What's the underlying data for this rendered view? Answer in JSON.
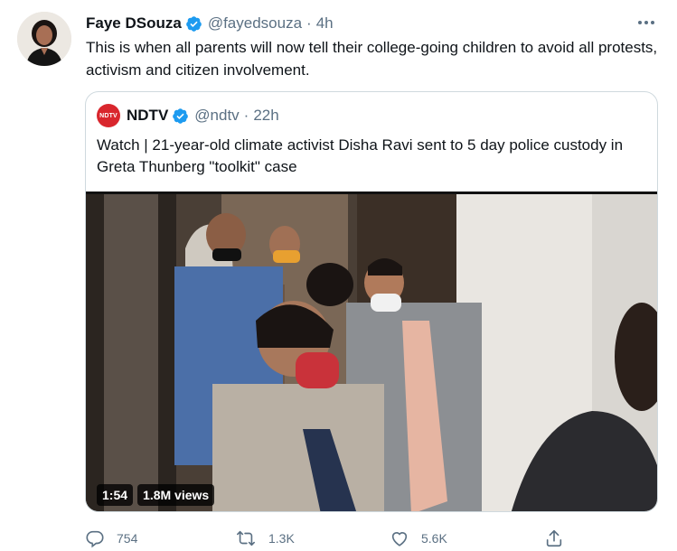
{
  "tweet": {
    "author_name": "Faye DSouza",
    "handle": "@fayedsouza",
    "separator": "·",
    "time": "4h",
    "text": "This is when all parents will now tell their college-going children to avoid all protests, activism and citizen involvement."
  },
  "quoted": {
    "logo_text": "NDTV",
    "author_name": "NDTV",
    "handle": "@ndtv",
    "separator": "·",
    "time": "22h",
    "text": "Watch | 21-year-old climate activist Disha Ravi sent to 5 day police custody in Greta Thunberg \"toolkit\" case",
    "video": {
      "duration": "1:54",
      "views": "1.8M views"
    }
  },
  "actions": {
    "replies": "754",
    "retweets": "1.3K",
    "likes": "5.6K"
  },
  "colors": {
    "verified": "#1d9bf0",
    "secondary_text": "#5b7083",
    "ndtv_red": "#d9262d"
  }
}
